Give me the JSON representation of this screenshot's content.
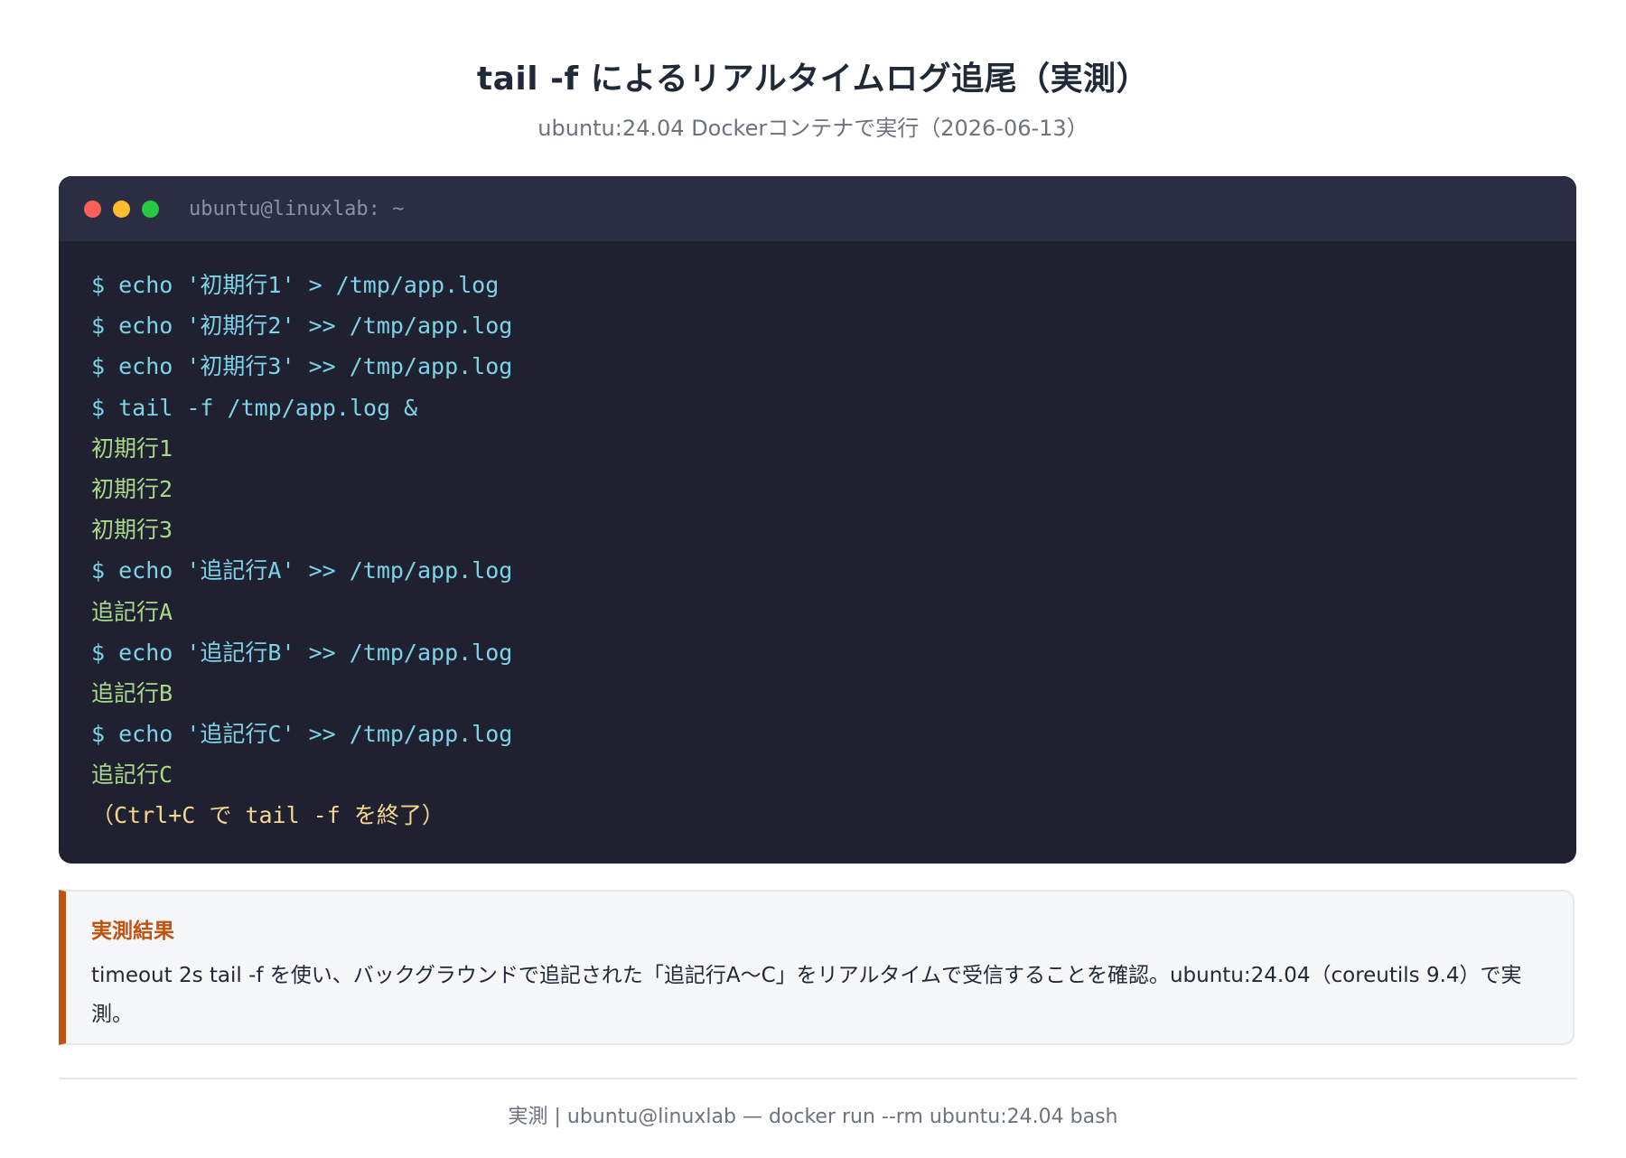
{
  "header": {
    "title": "tail -f によるリアルタイムログ追尾（実測）",
    "subtitle": "ubuntu:24.04 Dockerコンテナで実行（2026-06-13）"
  },
  "terminal": {
    "title": "ubuntu@linuxlab: ~",
    "controls": [
      "close",
      "minimize",
      "maximize"
    ],
    "lines": [
      {
        "type": "cmd",
        "text": "$ echo '初期行1' > /tmp/app.log"
      },
      {
        "type": "cmd",
        "text": "$ echo '初期行2' >> /tmp/app.log"
      },
      {
        "type": "cmd",
        "text": "$ echo '初期行3' >> /tmp/app.log"
      },
      {
        "type": "cmd",
        "text": "$ tail -f /tmp/app.log &"
      },
      {
        "type": "out",
        "text": "初期行1"
      },
      {
        "type": "out",
        "text": "初期行2"
      },
      {
        "type": "out",
        "text": "初期行3"
      },
      {
        "type": "cmd",
        "text": "$ echo '追記行A' >> /tmp/app.log"
      },
      {
        "type": "out",
        "text": "追記行A"
      },
      {
        "type": "cmd",
        "text": "$ echo '追記行B' >> /tmp/app.log"
      },
      {
        "type": "out",
        "text": "追記行B"
      },
      {
        "type": "cmd",
        "text": "$ echo '追記行C' >> /tmp/app.log"
      },
      {
        "type": "out",
        "text": "追記行C"
      },
      {
        "type": "note",
        "text": "（Ctrl+C で tail -f を終了）"
      }
    ]
  },
  "result": {
    "title": "実測結果",
    "text": "timeout 2s tail -f を使い、バックグラウンドで追記された「追記行A〜C」をリアルタイムで受信することを確認。ubuntu:24.04（coreutils 9.4）で実測。"
  },
  "footer": {
    "text": "実測 | ubuntu@linuxlab — docker run --rm ubuntu:24.04 bash"
  },
  "colors": {
    "accent": "#c2520f",
    "terminal_bg": "#1f2030",
    "terminal_header": "#2b2d42",
    "command": "#7dd3e8",
    "output": "#a8d98a",
    "note": "#f5d78e"
  }
}
